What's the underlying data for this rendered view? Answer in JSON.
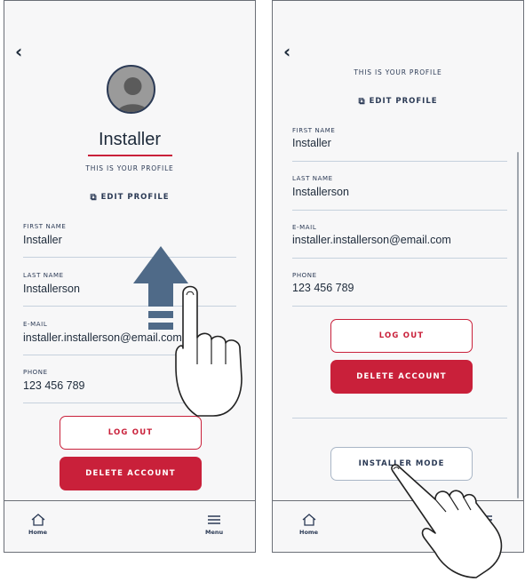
{
  "screen_left": {
    "profile_name": "Installer",
    "subtitle": "THIS IS YOUR PROFILE",
    "edit_profile": "EDIT PROFILE",
    "fields": [
      {
        "label": "FIRST NAME",
        "value": "Installer"
      },
      {
        "label": "LAST NAME",
        "value": "Installerson"
      },
      {
        "label": "E-MAIL",
        "value": "installer.installerson@email.com"
      },
      {
        "label": "PHONE",
        "value": "123 456 789"
      }
    ],
    "logout_label": "LOG OUT",
    "delete_label": "DELETE ACCOUNT",
    "tab_home": "Home",
    "tab_menu": "Menu"
  },
  "screen_right": {
    "subtitle": "THIS IS YOUR PROFILE",
    "edit_profile": "EDIT PROFILE",
    "fields": [
      {
        "label": "FIRST NAME",
        "value": "Installer"
      },
      {
        "label": "LAST NAME",
        "value": "Installerson"
      },
      {
        "label": "E-MAIL",
        "value": "installer.installerson@email.com"
      },
      {
        "label": "PHONE",
        "value": "123 456 789"
      }
    ],
    "logout_label": "LOG OUT",
    "delete_label": "DELETE ACCOUNT",
    "installer_mode_label": "INSTALLER MODE",
    "tab_home": "Home"
  },
  "colors": {
    "accent_red": "#c9203a",
    "navy": "#2b3a55",
    "divider": "#c6d1dd"
  },
  "icons": [
    "back-chevron-icon",
    "link-icon",
    "home-icon",
    "menu-icon",
    "swipe-up-arrow-icon",
    "pointing-hand-icon"
  ]
}
